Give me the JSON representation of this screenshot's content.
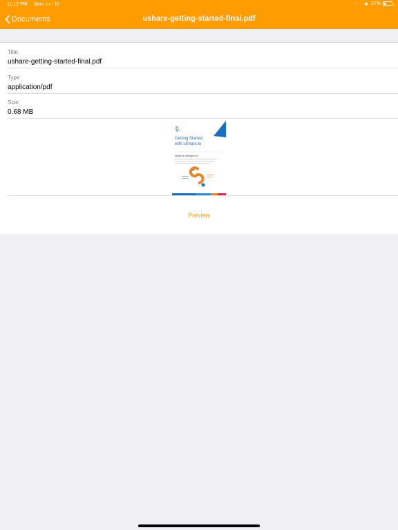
{
  "status_bar": {
    "time": "11:12 PM",
    "date": "Mon Jun 10",
    "battery": "27%",
    "battery_level": 0.27
  },
  "nav": {
    "back_label": "Documents",
    "title": "ushare-getting-started-final.pdf"
  },
  "fields": [
    {
      "label": "Title",
      "value": "ushare-getting-started-final.pdf"
    },
    {
      "label": "Type",
      "value": "application/pdf"
    },
    {
      "label": "Size",
      "value": "0.68 MB"
    }
  ],
  "thumbnail": {
    "heading": "Getting Started with uShare.to",
    "subheading": "What is uShare.to?"
  },
  "preview_label": "Preview",
  "colors": {
    "accent": "#ff9c00",
    "background": "#efeff4",
    "separator": "#dcdce0"
  }
}
